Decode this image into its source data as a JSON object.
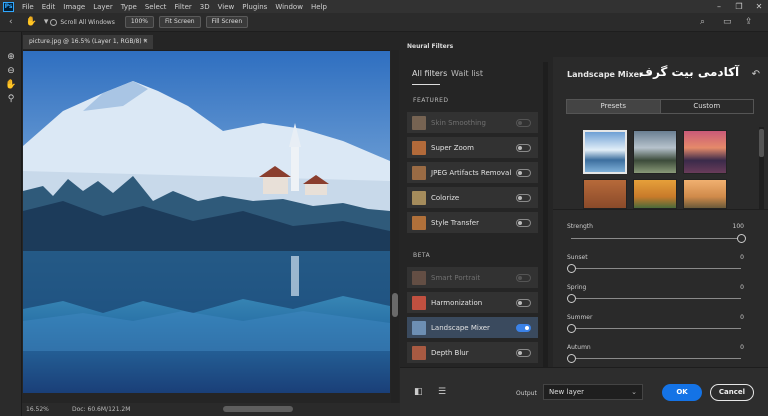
{
  "app": {
    "logo": "Ps"
  },
  "menu": [
    "File",
    "Edit",
    "Image",
    "Layer",
    "Type",
    "Select",
    "Filter",
    "3D",
    "View",
    "Plugins",
    "Window",
    "Help"
  ],
  "options": {
    "scroll_all": "Scroll All Windows",
    "zoom": "100%",
    "fit": "Fit Screen",
    "fill": "Fill Screen"
  },
  "doc_tab": "picture.jpg @ 16.5% (Layer 1, RGB/8) *",
  "status": {
    "zoom": "16.52%",
    "doc": "Doc: 60.6M/121.2M"
  },
  "neural": {
    "title": "Neural Filters",
    "tabs": [
      "All filters",
      "Wait list"
    ],
    "featured_label": "FEATURED",
    "beta_label": "BETA",
    "featured": [
      {
        "label": "Skin Smoothing",
        "disabled": true,
        "on": false,
        "color": "#c9a07a"
      },
      {
        "label": "Super Zoom",
        "disabled": false,
        "on": false,
        "color": "#b26a3a"
      },
      {
        "label": "JPEG Artifacts Removal",
        "disabled": false,
        "on": false,
        "color": "#9a6b44"
      },
      {
        "label": "Colorize",
        "disabled": false,
        "on": false,
        "color": "#a58c5c"
      },
      {
        "label": "Style Transfer",
        "disabled": false,
        "on": false,
        "color": "#b0703a"
      }
    ],
    "beta": [
      {
        "label": "Smart Portrait",
        "disabled": true,
        "on": false,
        "color": "#a0705c"
      },
      {
        "label": "Harmonization",
        "disabled": false,
        "on": false,
        "color": "#c05040"
      },
      {
        "label": "Landscape Mixer",
        "disabled": false,
        "on": true,
        "color": "#6d8fb4"
      },
      {
        "label": "Depth Blur",
        "disabled": false,
        "on": false,
        "color": "#a85a42"
      }
    ]
  },
  "settings": {
    "title": "Landscape Mixer",
    "logo_text": "آکادمی بیت گرف",
    "tabs": [
      "Presets",
      "Custom"
    ],
    "sliders": [
      {
        "label": "Strength",
        "value": "100",
        "level": 1.0
      },
      {
        "label": "Sunset",
        "value": "0",
        "level": 0.0
      },
      {
        "label": "Spring",
        "value": "0",
        "level": 0.0
      },
      {
        "label": "Summer",
        "value": "0",
        "level": 0.0
      },
      {
        "label": "Autumn",
        "value": "0",
        "level": 0.0
      }
    ]
  },
  "footer": {
    "output_label": "Output",
    "output_value": "New layer",
    "ok": "OK",
    "cancel": "Cancel"
  }
}
